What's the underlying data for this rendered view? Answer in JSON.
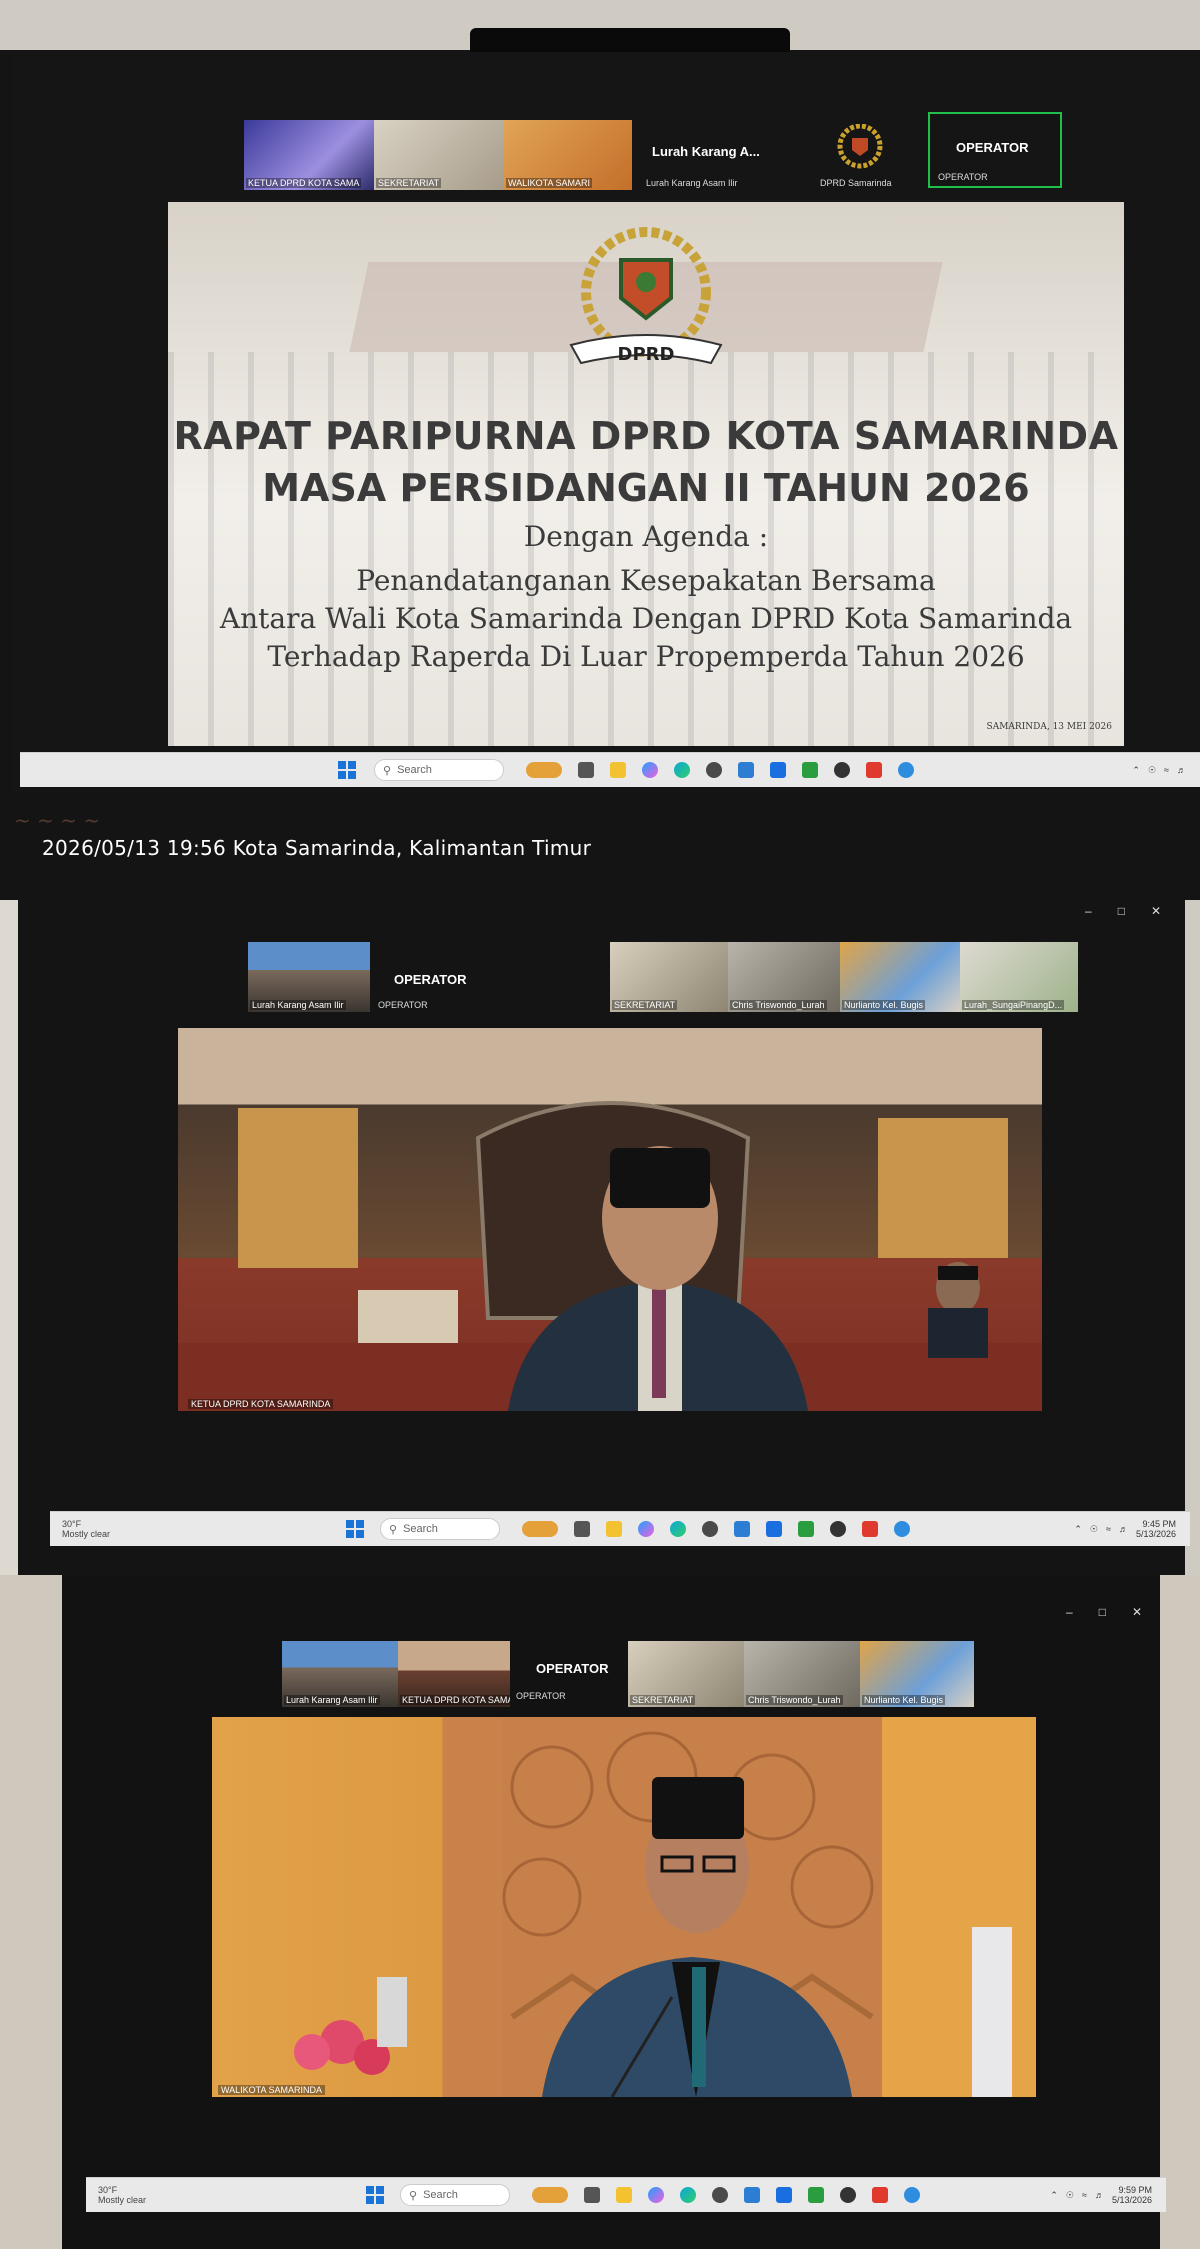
{
  "photo1": {
    "tiles": [
      {
        "caption": "KETUA DPRD KOTA SAMA"
      },
      {
        "caption": "SEKRETARIAT"
      },
      {
        "caption": "WALIKOTA SAMARI"
      }
    ],
    "lurah_tile": {
      "title": "Lurah Karang A...",
      "caption": "Lurah Karang Asam Ilir"
    },
    "dprd_tile": {
      "caption": "DPRD Samarinda"
    },
    "operator_tile": {
      "title": "OPERATOR",
      "caption": "OPERATOR"
    },
    "slide": {
      "emblem_label": "DPRD",
      "line1": "RAPAT PARIPURNA DPRD KOTA SAMARINDA",
      "line2": "MASA PERSIDANGAN II TAHUN 2026",
      "line3": "Dengan Agenda :",
      "line4": "Penandatanganan Kesepakatan Bersama",
      "line5": "Antara Wali Kota Samarinda Dengan DPRD Kota Samarinda",
      "line6": "Terhadap Raperda Di Luar Propemperda Tahun 2026",
      "footer": "SAMARINDA, 13 MEI 2026"
    },
    "taskbar": {
      "search": "Search"
    },
    "overlay": "2026/05/13 19:56  Kota Samarinda, Kalimantan Timur"
  },
  "photo2": {
    "lurah_caption": "Lurah Karang Asam Ilir",
    "operator_title": "OPERATOR",
    "operator_caption": "OPERATOR",
    "tiles": [
      {
        "caption": "SEKRETARIAT"
      },
      {
        "caption": "Chris Triswondo_Lurah"
      },
      {
        "caption": "Nurlianto Kel. Bugis"
      },
      {
        "caption": "Lurah_SungaiPinangD..."
      }
    ],
    "main_caption": "KETUA DPRD KOTA SAMARINDA",
    "taskbar": {
      "search": "Search",
      "weather_temp": "30°F",
      "weather_desc": "Mostly clear",
      "time": "9:45 PM",
      "date": "5/13/2026"
    }
  },
  "photo3": {
    "tiles_left": [
      {
        "caption": "Lurah Karang Asam Ilir"
      },
      {
        "caption": "KETUA DPRD KOTA SAMA..."
      }
    ],
    "operator_title": "OPERATOR",
    "operator_caption": "OPERATOR",
    "tiles_right": [
      {
        "caption": "SEKRETARIAT"
      },
      {
        "caption": "Chris Triswondo_Lurah"
      },
      {
        "caption": "Nurlianto Kel. Bugis"
      }
    ],
    "main_caption": "WALIKOTA SAMARINDA",
    "taskbar": {
      "search": "Search",
      "weather_temp": "30°F",
      "weather_desc": "Mostly clear",
      "time": "9:59 PM",
      "date": "5/13/2026"
    }
  }
}
